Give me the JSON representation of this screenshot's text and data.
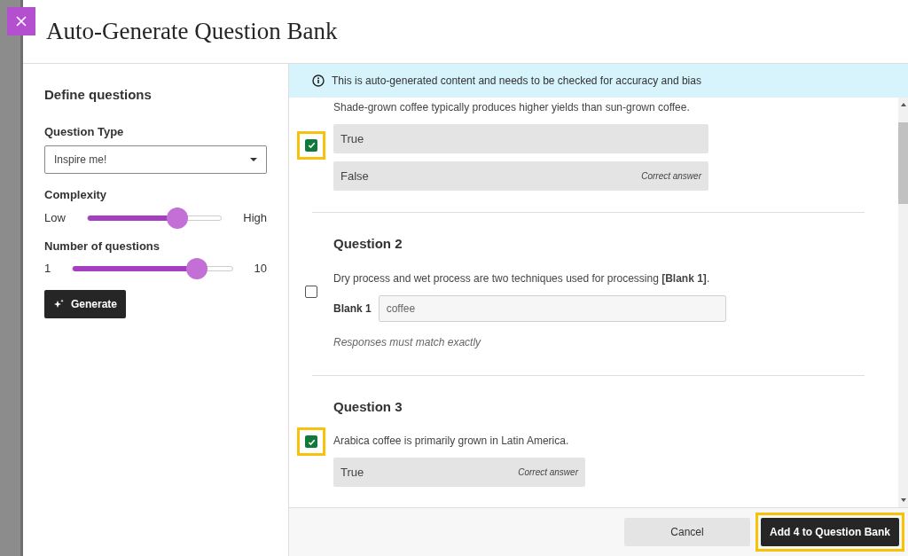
{
  "dialog": {
    "title": "Auto-Generate Question Bank"
  },
  "sidebar": {
    "heading": "Define questions",
    "question_type": {
      "label": "Question Type",
      "value": "Inspire me!"
    },
    "sliders": [
      {
        "label": "Complexity",
        "min_label": "Low",
        "max_label": "High",
        "level": 0.67
      },
      {
        "label": "Number of questions",
        "min_label": "1",
        "max_label": "10",
        "level": 0.78
      }
    ],
    "generate_button": "Generate"
  },
  "notice": "This is auto-generated content and needs to be checked for accuracy and bias",
  "questions": [
    {
      "kind": "choice",
      "statement": "Shade-grown coffee typically produces higher yields than sun-grown coffee.",
      "checked": true,
      "highlighted": true,
      "options": [
        {
          "label": "True"
        },
        {
          "label": "False",
          "note": "Correct answer"
        }
      ]
    },
    {
      "kind": "fill",
      "title": "Question 2",
      "statement": "Dry process and wet process are two techniques used for processing **[Blank 1]**.",
      "checked": false,
      "highlighted": false,
      "blank_label": "Blank 1",
      "blank_value": "coffee",
      "hint": "Responses must match exactly"
    },
    {
      "kind": "choice",
      "title": "Question 3",
      "statement": "Arabica coffee is primarily grown in Latin America.",
      "checked": true,
      "highlighted": true,
      "options": [
        {
          "label": "True",
          "note": "Correct answer"
        }
      ]
    }
  ],
  "footer": {
    "cancel": "Cancel",
    "add": {
      "label": "Add 4 to Question Bank",
      "highlighted": true
    }
  }
}
